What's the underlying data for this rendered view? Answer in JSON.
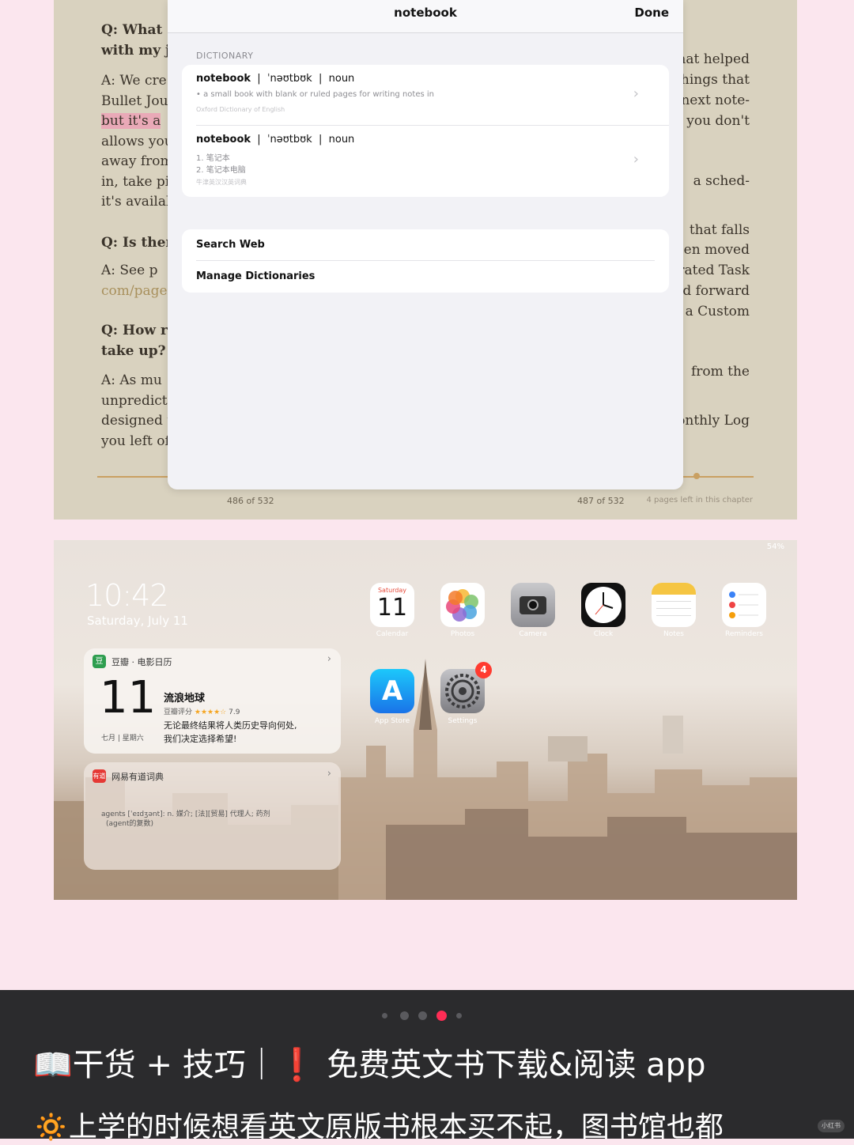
{
  "reader": {
    "left_lines": [
      {
        "text": "Q: What c",
        "q": true
      },
      {
        "text": "with my jo",
        "q": true
      },
      {
        "text": "A: We cre"
      },
      {
        "text": "Bullet Jour"
      },
      {
        "text": "but it's a ",
        "hl": true
      },
      {
        "text": "allows you"
      },
      {
        "text": "away from"
      },
      {
        "text": "in, take pi"
      },
      {
        "text": "it's availab"
      },
      {
        "text": "Q: Is there",
        "q": true
      },
      {
        "text": "A: See p"
      },
      {
        "text": "com/pages",
        "link": true
      },
      {
        "text": "Q: How r",
        "q": true
      },
      {
        "text": "take up?",
        "q": true
      },
      {
        "text": "A: As mu"
      },
      {
        "text": "unpredicta"
      },
      {
        "text": "designed t"
      },
      {
        "text": "you left off"
      }
    ],
    "right_lines": [
      "hat helped",
      "hings that",
      "next note-",
      "t you don't",
      "a sched-",
      "that falls",
      "een moved",
      "grated Task",
      "ed forward",
      "a Custom",
      "from the",
      "onthly Log"
    ],
    "page_left": "486 of 532",
    "page_right": "487 of 532",
    "chapter_remaining": "4 pages left in this chapter",
    "progress_fraction": 0.91
  },
  "dictionary": {
    "title": "notebook",
    "done_label": "Done",
    "section_label": "DICTIONARY",
    "entries": [
      {
        "word": "notebook",
        "pron": "ˈnəʊtbʊk",
        "pos": "noun",
        "def": "• a small book with blank or ruled pages for writing notes in",
        "source": "Oxford Dictionary of English"
      },
      {
        "word": "notebook",
        "pron": "ˈnəʊtbʊk",
        "pos": "noun",
        "def1": "1. 笔记本",
        "def2": "2. 笔记本电脑",
        "source": "牛津英汉汉英词典"
      }
    ],
    "actions": [
      "Search Web",
      "Manage Dictionaries"
    ]
  },
  "homescreen": {
    "status": "54%",
    "time": "10:42",
    "date": "Saturday, July 11",
    "apps": [
      {
        "name": "Calendar",
        "day": "Saturday",
        "num": "11"
      },
      {
        "name": "Photos"
      },
      {
        "name": "Camera"
      },
      {
        "name": "Clock"
      },
      {
        "name": "Notes"
      },
      {
        "name": "Reminders"
      },
      {
        "name": "App Store"
      },
      {
        "name": "Settings",
        "badge": "4"
      }
    ],
    "douban_widget": {
      "title": "豆瓣 · 电影日历",
      "day": "11",
      "month": "七月",
      "weekday": "星期六",
      "movie": "流浪地球",
      "rating_label": "豆瓣评分",
      "stars": "★★★★☆",
      "rating": "7.9",
      "quote1": "无论最终结果将人类历史导向何处,",
      "quote2": "我们决定选择希望!"
    },
    "youdao_widget": {
      "title": "网易有道词典",
      "text1": "agents [ˈeɪdʒənt]: n. 媒介; [法][贸易] 代理人; 药剂",
      "text2": "(agent的复数)"
    }
  },
  "caption": {
    "title": "📖干货 + 技巧｜❗️ 免费英文书下载&阅读 app",
    "body": "🔅上学的时候想看英文原版书根本买不起，图书馆也都",
    "watermark": "小红书",
    "dots_active_index": 3
  },
  "colors": {
    "page_bg": "#fbe6ee",
    "book_bg": "#d9d2bf",
    "highlight": "#e9a9b7",
    "accent_gold": "#c9a062",
    "badge_red": "#ff3b30"
  }
}
